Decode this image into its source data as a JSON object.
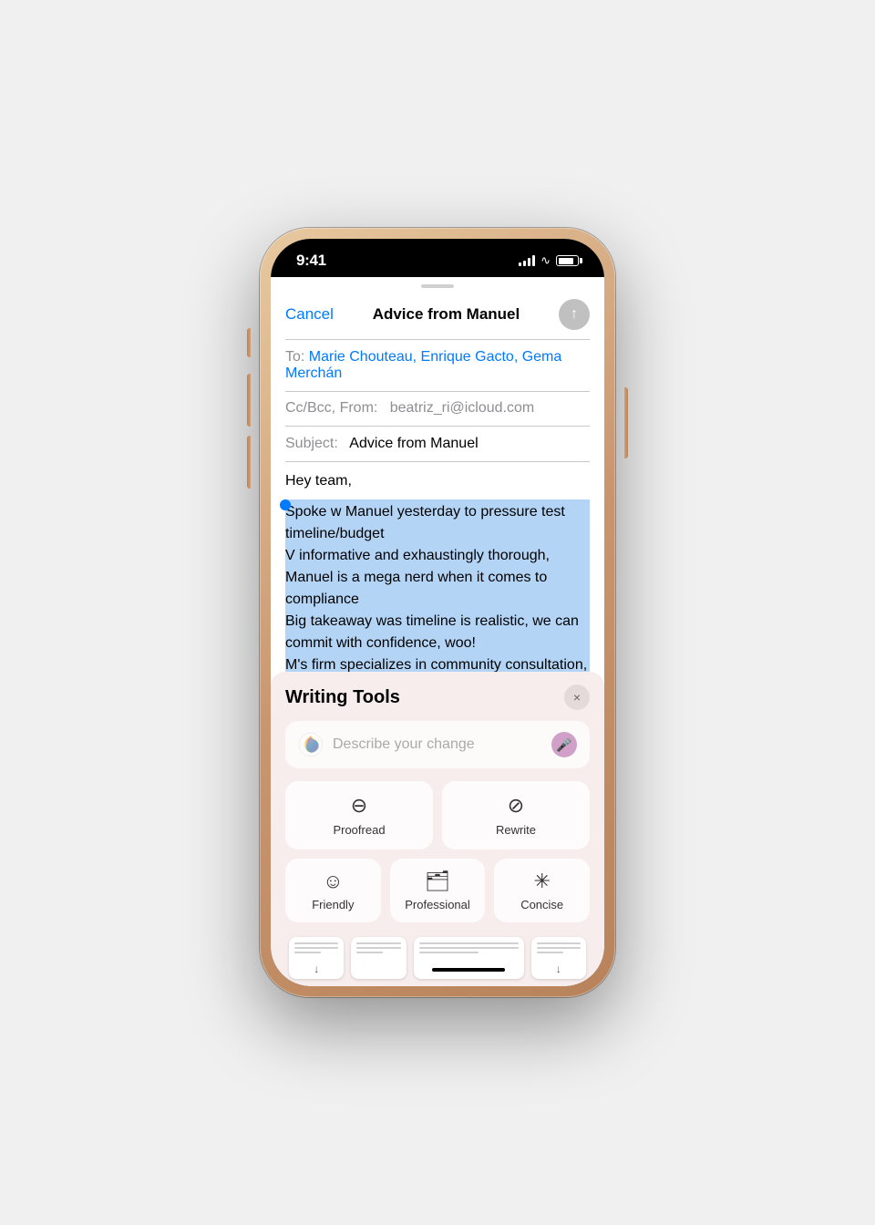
{
  "phone": {
    "status_bar": {
      "time": "9:41",
      "signal_label": "signal",
      "wifi_label": "wifi",
      "battery_label": "battery"
    }
  },
  "email": {
    "cancel_label": "Cancel",
    "title": "Advice from Manuel",
    "to_label": "To:",
    "to_value": "Marie Chouteau, Enrique Gacto, Gema Merchán",
    "cc_label": "Cc/Bcc, From:",
    "cc_value": "beatriz_ri@icloud.com",
    "subject_label": "Subject:",
    "subject_value": "Advice from Manuel",
    "body_greeting": "Hey team,",
    "body_selected": "Spoke w Manuel yesterday to pressure test timeline/budget\nV informative and exhaustingly thorough, Manuel is a mega nerd when it comes to compliance\nBig takeaway was timeline is realistic, we can commit with confidence, woo!\nM's firm specializes in community consultation, we need help here, should consider engaging\nthem for more if we can land it"
  },
  "writing_tools": {
    "title": "Writing Tools",
    "close_label": "×",
    "describe_placeholder": "Describe your change",
    "proofread_label": "Proofread",
    "rewrite_label": "Rewrite",
    "friendly_label": "Friendly",
    "professional_label": "Professional",
    "concise_label": "Concise"
  }
}
